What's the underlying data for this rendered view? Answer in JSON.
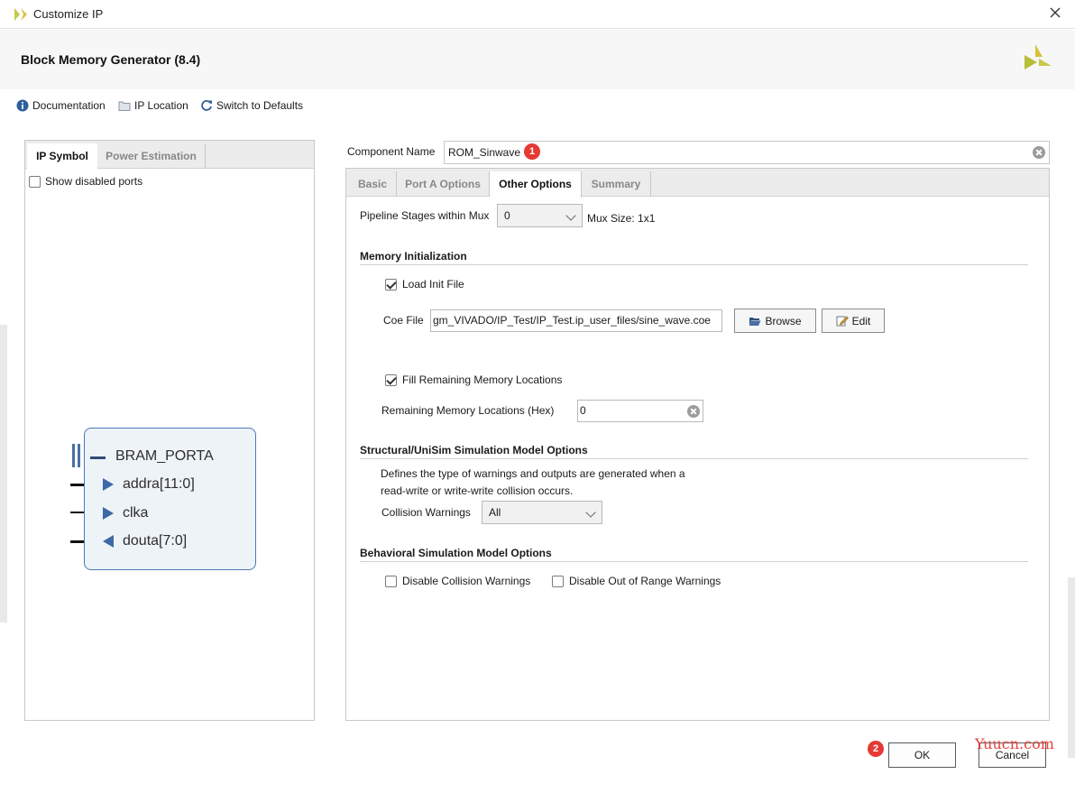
{
  "window": {
    "title": "Customize IP"
  },
  "header": {
    "title": "Block Memory Generator (8.4)"
  },
  "toolbar": {
    "documentation": "Documentation",
    "ip_location": "IP Location",
    "switch_defaults": "Switch to Defaults"
  },
  "left": {
    "tabs": [
      "IP Symbol",
      "Power Estimation"
    ],
    "show_disabled": "Show disabled ports",
    "symbol": {
      "bus": "BRAM_PORTA",
      "pins": [
        "addra[11:0]",
        "clka",
        "douta[7:0]"
      ]
    }
  },
  "component": {
    "label": "Component Name",
    "value": "ROM_Sinwave",
    "badge": "1"
  },
  "tabs": [
    "Basic",
    "Port A Options",
    "Other Options",
    "Summary"
  ],
  "options": {
    "pipeline_label": "Pipeline Stages within Mux",
    "pipeline_value": "0",
    "mux_size": "Mux Size: 1x1",
    "mem_init_title": "Memory Initialization",
    "load_init": "Load Init File",
    "coe_label": "Coe File",
    "coe_value": "gm_VIVADO/IP_Test/IP_Test.ip_user_files/sine_wave.coe",
    "browse": "Browse",
    "edit": "Edit",
    "fill_remaining": "Fill Remaining Memory Locations",
    "remaining_label": "Remaining Memory Locations (Hex)",
    "remaining_value": "0",
    "structural_title": "Structural/UniSim Simulation Model Options",
    "structural_desc_1": "Defines the type of warnings and outputs are generated when a",
    "structural_desc_2": "read-write or write-write collision occurs.",
    "collision_label": "Collision Warnings",
    "collision_value": "All",
    "behavioral_title": "Behavioral Simulation Model Options",
    "disable_collision": "Disable Collision Warnings",
    "disable_range": "Disable Out of Range Warnings"
  },
  "footer": {
    "ok": "OK",
    "cancel": "Cancel",
    "badge": "2",
    "watermark": "Yuucn.com"
  },
  "colors": {
    "accent": "#4a7bb5",
    "badge": "#e53935",
    "logo": "#c4c94a"
  }
}
